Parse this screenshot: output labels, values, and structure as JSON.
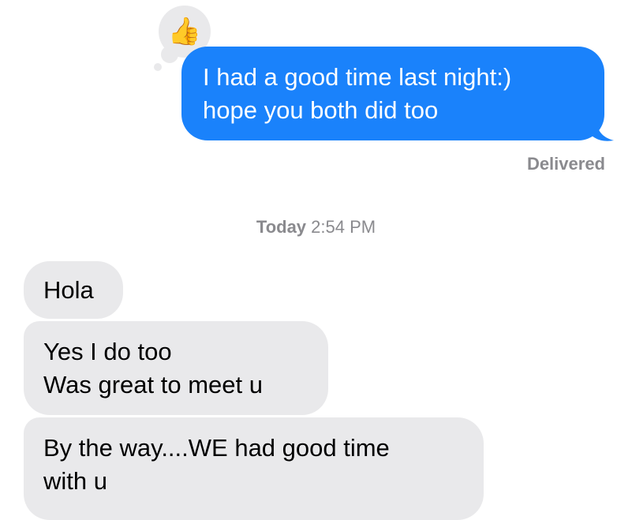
{
  "sent_message": {
    "lines": [
      "I had a good time last night:)",
      "hope you both did too"
    ],
    "reaction": "👍",
    "reaction_icon": "thumbs-up-icon",
    "status": "Delivered",
    "bubble_color": "#1a82fb"
  },
  "divider": {
    "day": "Today",
    "time": "2:54 PM"
  },
  "received_messages": [
    {
      "lines": [
        "Hola"
      ]
    },
    {
      "lines": [
        "Yes I do too",
        "Was great to meet u"
      ]
    },
    {
      "lines": [
        "By the way....WE had good time",
        "with u"
      ]
    }
  ],
  "colors": {
    "received_bubble": "#e9e9eb",
    "meta_text": "#8a8a8e"
  }
}
